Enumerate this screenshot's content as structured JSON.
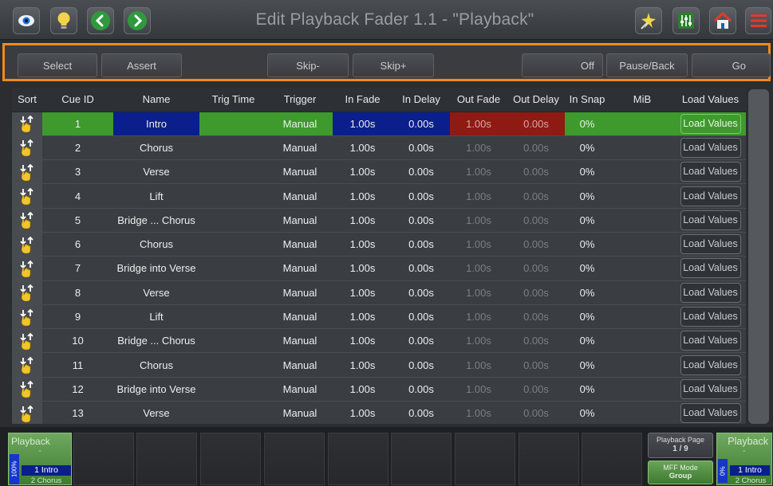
{
  "title": "Edit Playback Fader 1.1 - \"Playback\"",
  "titlebar_icons": {
    "left": [
      "eye-icon",
      "lightbulb-icon",
      "back-arrow-icon",
      "forward-arrow-icon"
    ],
    "right": [
      "magic-wand-icon",
      "fader-panel-icon",
      "home-icon",
      "menu-icon"
    ]
  },
  "toolbar": {
    "select": "Select",
    "assert": "Assert",
    "skip_minus": "Skip-",
    "skip_plus": "Skip+",
    "off": "Off",
    "pause_back": "Pause/Back",
    "go": "Go"
  },
  "columns": [
    "Sort",
    "Cue ID",
    "Name",
    "Trig Time",
    "Trigger",
    "In Fade",
    "In Delay",
    "Out Fade",
    "Out Delay",
    "In Snap",
    "MiB",
    "Load Values"
  ],
  "rows": [
    {
      "id": "1",
      "name": "Intro",
      "trig_time": "",
      "trigger": "Manual",
      "in_fade": "1.00s",
      "in_delay": "0.00s",
      "out_fade": "1.00s",
      "out_delay": "0.00s",
      "in_snap": "0%",
      "mib": "",
      "load": "Load Values"
    },
    {
      "id": "2",
      "name": "Chorus",
      "trig_time": "",
      "trigger": "Manual",
      "in_fade": "1.00s",
      "in_delay": "0.00s",
      "out_fade": "1.00s",
      "out_delay": "0.00s",
      "in_snap": "0%",
      "mib": "",
      "load": "Load Values"
    },
    {
      "id": "3",
      "name": "Verse",
      "trig_time": "",
      "trigger": "Manual",
      "in_fade": "1.00s",
      "in_delay": "0.00s",
      "out_fade": "1.00s",
      "out_delay": "0.00s",
      "in_snap": "0%",
      "mib": "",
      "load": "Load Values"
    },
    {
      "id": "4",
      "name": "Lift",
      "trig_time": "",
      "trigger": "Manual",
      "in_fade": "1.00s",
      "in_delay": "0.00s",
      "out_fade": "1.00s",
      "out_delay": "0.00s",
      "in_snap": "0%",
      "mib": "",
      "load": "Load Values"
    },
    {
      "id": "5",
      "name": "Bridge ... Chorus",
      "trig_time": "",
      "trigger": "Manual",
      "in_fade": "1.00s",
      "in_delay": "0.00s",
      "out_fade": "1.00s",
      "out_delay": "0.00s",
      "in_snap": "0%",
      "mib": "",
      "load": "Load Values"
    },
    {
      "id": "6",
      "name": "Chorus",
      "trig_time": "",
      "trigger": "Manual",
      "in_fade": "1.00s",
      "in_delay": "0.00s",
      "out_fade": "1.00s",
      "out_delay": "0.00s",
      "in_snap": "0%",
      "mib": "",
      "load": "Load Values"
    },
    {
      "id": "7",
      "name": "Bridge into Verse",
      "trig_time": "",
      "trigger": "Manual",
      "in_fade": "1.00s",
      "in_delay": "0.00s",
      "out_fade": "1.00s",
      "out_delay": "0.00s",
      "in_snap": "0%",
      "mib": "",
      "load": "Load Values"
    },
    {
      "id": "8",
      "name": "Verse",
      "trig_time": "",
      "trigger": "Manual",
      "in_fade": "1.00s",
      "in_delay": "0.00s",
      "out_fade": "1.00s",
      "out_delay": "0.00s",
      "in_snap": "0%",
      "mib": "",
      "load": "Load Values"
    },
    {
      "id": "9",
      "name": "Lift",
      "trig_time": "",
      "trigger": "Manual",
      "in_fade": "1.00s",
      "in_delay": "0.00s",
      "out_fade": "1.00s",
      "out_delay": "0.00s",
      "in_snap": "0%",
      "mib": "",
      "load": "Load Values"
    },
    {
      "id": "10",
      "name": "Bridge ... Chorus",
      "trig_time": "",
      "trigger": "Manual",
      "in_fade": "1.00s",
      "in_delay": "0.00s",
      "out_fade": "1.00s",
      "out_delay": "0.00s",
      "in_snap": "0%",
      "mib": "",
      "load": "Load Values"
    },
    {
      "id": "11",
      "name": "Chorus",
      "trig_time": "",
      "trigger": "Manual",
      "in_fade": "1.00s",
      "in_delay": "0.00s",
      "out_fade": "1.00s",
      "out_delay": "0.00s",
      "in_snap": "0%",
      "mib": "",
      "load": "Load Values"
    },
    {
      "id": "12",
      "name": "Bridge into Verse",
      "trig_time": "",
      "trigger": "Manual",
      "in_fade": "1.00s",
      "in_delay": "0.00s",
      "out_fade": "1.00s",
      "out_delay": "0.00s",
      "in_snap": "0%",
      "mib": "",
      "load": "Load Values"
    },
    {
      "id": "13",
      "name": "Verse",
      "trig_time": "",
      "trigger": "Manual",
      "in_fade": "1.00s",
      "in_delay": "0.00s",
      "out_fade": "1.00s",
      "out_delay": "0.00s",
      "in_snap": "0%",
      "mib": "",
      "load": "Load Values"
    }
  ],
  "active_row_index": 0,
  "bottom": {
    "left_playback": {
      "title": "Playback",
      "dash": "-",
      "level": "100%",
      "current": "1 Intro",
      "next": "2 Chorus"
    },
    "right_playback": {
      "title": "Playback",
      "dash": "-",
      "level": "0%",
      "current": "1 Intro",
      "next": "2 Chorus"
    },
    "playback_page": {
      "label": "Playback Page",
      "value": "1 / 9"
    },
    "mff_mode": {
      "label": "MFF Mode",
      "value": "Group"
    }
  },
  "colors": {
    "accent_orange": "#f08a1c",
    "active_green": "#3e9a2d",
    "active_blue": "#0a1f8c",
    "active_red": "#8f1a14"
  }
}
